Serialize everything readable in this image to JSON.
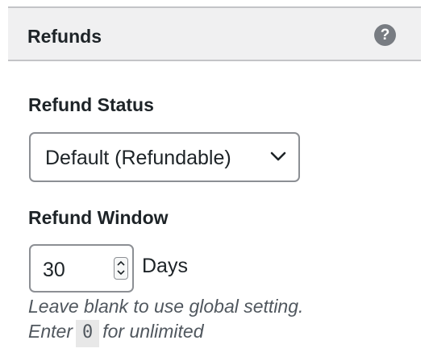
{
  "panel": {
    "title": "Refunds",
    "help_icon": "question-mark-icon",
    "help_glyph": "?"
  },
  "refund_status": {
    "label": "Refund Status",
    "selected": "Default (Refundable)",
    "dropdown_icon": "chevron-down-icon"
  },
  "refund_window": {
    "label": "Refund Window",
    "value": "30",
    "unit": "Days",
    "help_line1": "Leave blank to use global setting.",
    "help_line2_before": "Enter",
    "help_code": "0",
    "help_line2_after": "for unlimited"
  },
  "colors": {
    "header_bg": "#f0f0f1",
    "border": "#8c8f94",
    "text": "#1d2327",
    "help_text": "#50575e",
    "help_icon_bg": "#787c82"
  }
}
